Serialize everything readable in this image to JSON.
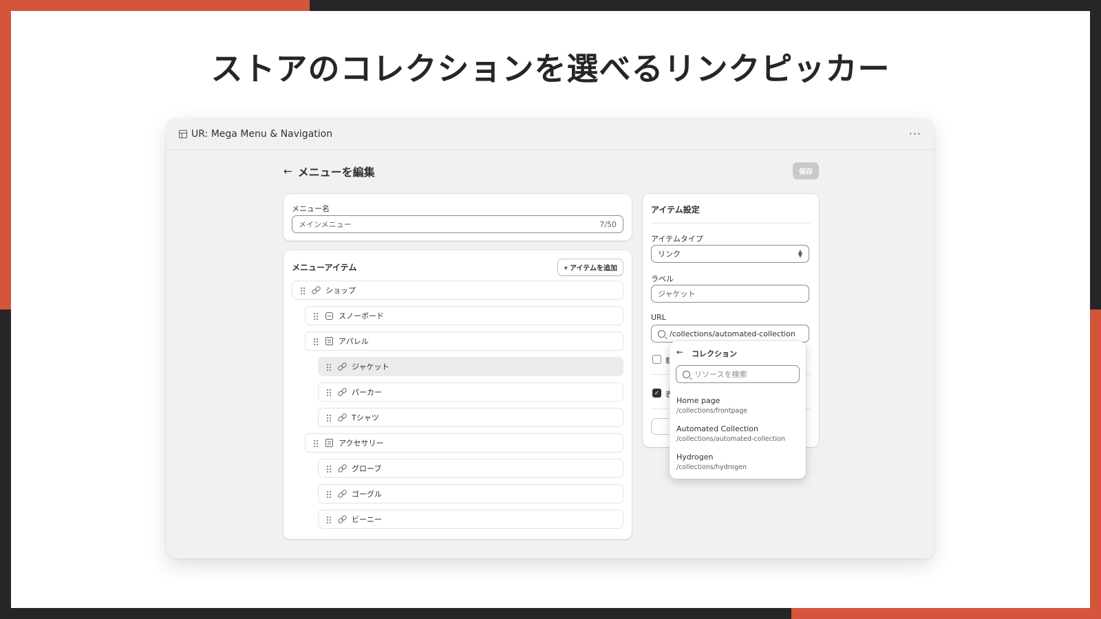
{
  "slide": {
    "headline": "ストアのコレクションを選べるリンクピッカー",
    "colors": {
      "accent": "#d4553c",
      "dark": "#262626"
    }
  },
  "window": {
    "title": "UR: Mega Menu & Navigation",
    "title_icon": "app-window-icon",
    "more_label": "···"
  },
  "page": {
    "back_label": "←",
    "title": "メニューを編集",
    "save_label": "保存"
  },
  "menu_name": {
    "label": "メニュー名",
    "value": "メインメニュー",
    "counter": "7/50"
  },
  "menu_items": {
    "title": "メニューアイテム",
    "add_label": "+ アイテムを追加",
    "items": [
      {
        "label": "ショップ",
        "icon": "link-icon",
        "depth": 0
      },
      {
        "label": "スノーボード",
        "icon": "image-icon",
        "depth": 1
      },
      {
        "label": "アパレル",
        "icon": "page-icon",
        "depth": 1
      },
      {
        "label": "ジャケット",
        "icon": "link-icon",
        "depth": 2,
        "selected": true
      },
      {
        "label": "パーカー",
        "icon": "link-icon",
        "depth": 2
      },
      {
        "label": "Tシャツ",
        "icon": "link-icon",
        "depth": 2
      },
      {
        "label": "アクセサリー",
        "icon": "page-icon",
        "depth": 1
      },
      {
        "label": "グローブ",
        "icon": "link-icon",
        "depth": 2
      },
      {
        "label": "ゴーグル",
        "icon": "link-icon",
        "depth": 2
      },
      {
        "label": "ビーニー",
        "icon": "link-icon",
        "depth": 2
      }
    ]
  },
  "item_settings": {
    "title": "アイテム設定",
    "type_label": "アイテムタイプ",
    "type_value": "リンク",
    "label_label": "ラベル",
    "label_value": "ジャケット",
    "url_label": "URL",
    "url_value": "/collections/automated-collection",
    "checkbox1_fragment": "新",
    "checkbox2_fragment": "表"
  },
  "picker": {
    "back_label": "←",
    "title": "コレクション",
    "search_placeholder": "リソースを検索",
    "results": [
      {
        "title": "Home page",
        "path": "/collections/frontpage"
      },
      {
        "title": "Automated Collection",
        "path": "/collections/automated-collection"
      },
      {
        "title": "Hydrogen",
        "path": "/collections/hydrogen"
      }
    ]
  }
}
